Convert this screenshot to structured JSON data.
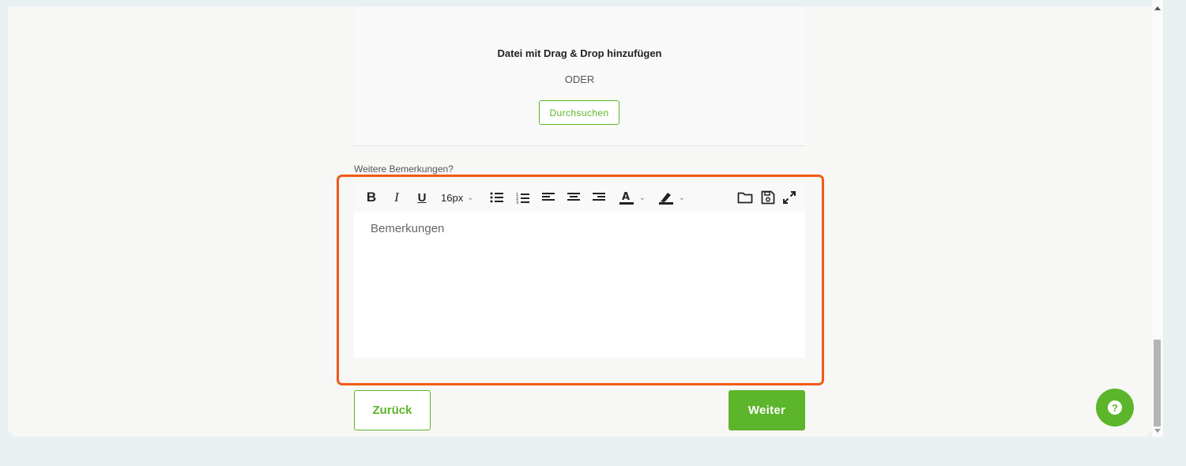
{
  "upload": {
    "drag_drop_text": "Datei mit Drag & Drop hinzufügen",
    "or_text": "ODER",
    "browse_label": "Durchsuchen"
  },
  "remarks": {
    "label": "Weitere Bemerkungen?",
    "placeholder": "Bemerkungen"
  },
  "toolbar": {
    "bold_label": "B",
    "italic_label": "I",
    "underline_label": "U",
    "font_size": "16px",
    "icons": [
      "bold-icon",
      "italic-icon",
      "underline-icon",
      "font-size-select",
      "bullet-list-icon",
      "numbered-list-icon",
      "align-left-icon",
      "align-center-icon",
      "align-right-icon",
      "text-color-icon",
      "highlight-color-icon",
      "folder-open-icon",
      "save-icon",
      "fullscreen-icon"
    ]
  },
  "navigation": {
    "back_label": "Zurück",
    "next_label": "Weiter"
  },
  "help": {
    "label": "?"
  },
  "colors": {
    "accent": "#5cb52a",
    "highlight_frame": "#f05a14",
    "page_background": "#e9f0f2"
  }
}
